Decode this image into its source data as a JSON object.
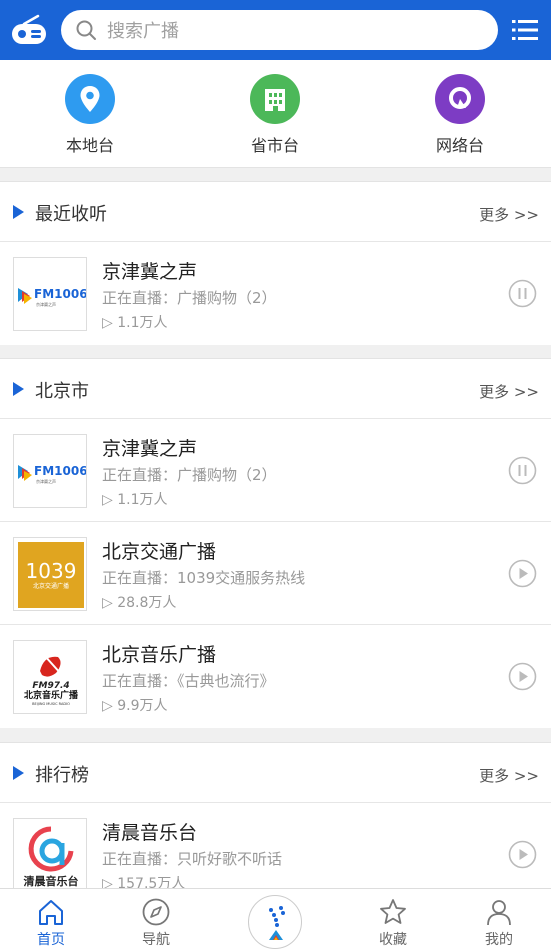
{
  "header": {
    "search_placeholder": "搜索广播"
  },
  "categories": [
    {
      "label": "本地台",
      "icon": "location-pin-icon",
      "color": "#2e9bf0"
    },
    {
      "label": "省市台",
      "icon": "building-icon",
      "color": "#4cb859"
    },
    {
      "label": "网络台",
      "icon": "network-q-icon",
      "color": "#7d3cc4"
    }
  ],
  "sections": [
    {
      "title": "最近收听",
      "more": "更多 >>",
      "items": [
        {
          "name": "京津冀之声",
          "live": "正在直播：广播购物（2）",
          "count": "▷ 1.1万人",
          "logo": "FM1006",
          "state": "pause"
        }
      ]
    },
    {
      "title": "北京市",
      "more": "更多 >>",
      "items": [
        {
          "name": "京津冀之声",
          "live": "正在直播：广播购物（2）",
          "count": "▷ 1.1万人",
          "logo": "FM1006",
          "state": "pause"
        },
        {
          "name": "北京交通广播",
          "live": "正在直播：1039交通服务热线",
          "count": "▷ 28.8万人",
          "logo": "1039",
          "state": "play"
        },
        {
          "name": "北京音乐广播",
          "live": "正在直播：《古典也流行》",
          "count": "▷ 9.9万人",
          "logo": "FM97.4",
          "state": "play"
        }
      ]
    },
    {
      "title": "排行榜",
      "more": "更多 >>",
      "items": [
        {
          "name": "清晨音乐台",
          "live": "正在直播：只听好歌不听话",
          "count": "▷ 157.5万人",
          "logo": "清晨音乐台",
          "state": "play"
        }
      ]
    }
  ],
  "logos": {
    "fm1006_text": "FM1006",
    "fm1006_sub": "京津冀之声",
    "l1039_text": "1039",
    "l1039_sub": "北京交通广播",
    "fm974_text": "FM97.4",
    "fm974_sub": "北京音乐广播",
    "fm974_en": "BEIJING MUSIC RADIO",
    "qc_text": "清晨音乐台"
  },
  "bottom_nav": [
    {
      "label": "首页",
      "icon": "home-icon",
      "active": true
    },
    {
      "label": "导航",
      "icon": "compass-icon",
      "active": false
    },
    {
      "label": "收藏",
      "icon": "star-icon",
      "active": false
    },
    {
      "label": "我的",
      "icon": "person-icon",
      "active": false
    }
  ],
  "colors": {
    "primary": "#1a64d6",
    "background": "#f0f0f0"
  }
}
